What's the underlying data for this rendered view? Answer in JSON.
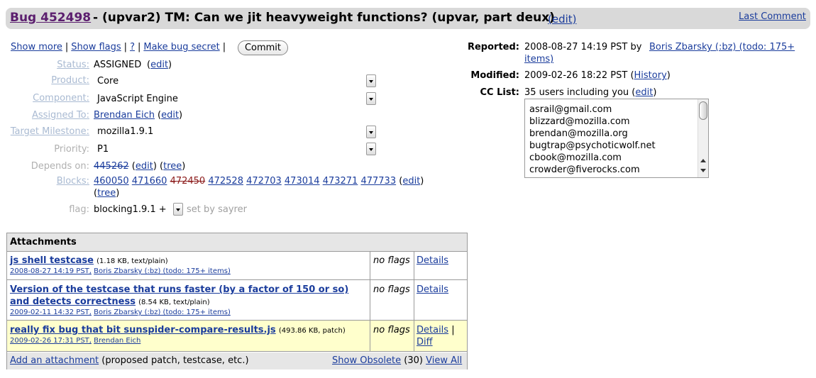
{
  "title": {
    "bug_id": "Bug 452498",
    "summary": "- (upvar2) TM: Can we jit heavyweight functions? (upvar, part deux)",
    "edit_label": "(edit)",
    "last_comment": "Last Comment"
  },
  "actions": {
    "show_more": "Show more",
    "show_flags": "Show flags",
    "help": "?",
    "make_secret": "Make bug secret",
    "commit": "Commit",
    "sep": "|"
  },
  "fields": {
    "status_label": "Status:",
    "status_value": "ASSIGNED",
    "status_edit": "edit",
    "product_label": "Product:",
    "product_value": "Core",
    "component_label": "Component:",
    "component_value": "JavaScript Engine",
    "assigned_label": "Assigned To:",
    "assigned_value": "Brendan Eich",
    "assigned_edit": "edit",
    "milestone_label": "Target Milestone:",
    "milestone_value": "mozilla1.9.1",
    "priority_label": "Priority:",
    "priority_value": "P1",
    "depends_label": "Depends on:",
    "depends_bug": "445262",
    "depends_edit": "edit",
    "depends_tree": "tree",
    "blocks_label": "Blocks:",
    "blocks": [
      "460050",
      "471660",
      "472450",
      "472528",
      "472703",
      "473014",
      "473271",
      "477733"
    ],
    "blocks_edit": "edit",
    "blocks_tree": "tree",
    "flag_label": "flag:",
    "flag_value": "blocking1.9.1 +",
    "flag_setter": "set by sayrer"
  },
  "meta": {
    "reported_label": "Reported:",
    "reported_date": "2008-08-27 14:19 PST by",
    "reporter": "Boris Zbarsky (:bz) (todo: 175+",
    "reporter_cont": "items)",
    "modified_label": "Modified:",
    "modified_date": "2009-02-26 18:22 PST (",
    "history": "History",
    "modified_close": ")",
    "cc_label": "CC List:",
    "cc_summary": "35 users including you (",
    "cc_edit": "edit",
    "cc_close": ")",
    "cc_list": [
      "asrail@gmail.com",
      "blizzard@mozilla.com",
      "brendan@mozilla.org",
      "bugtrap@psychoticwolf.net",
      "cbook@mozilla.com",
      "crowder@fiverocks.com"
    ]
  },
  "attachments": {
    "header": "Attachments",
    "rows": [
      {
        "title": "js shell testcase",
        "title2": "",
        "info": "(1.18 KB, text/plain)",
        "date": "2008-08-27 14:19 PST,",
        "author": "Boris Zbarsky (:bz) (todo: 175+ items)",
        "flags": "no flags",
        "details": "Details",
        "diff": ""
      },
      {
        "title": "Version of the testcase that runs faster (by a factor of 150 or so)",
        "title2": "and detects correctness",
        "info": "(8.54 KB, text/plain)",
        "date": "2009-02-11 14:32 PST,",
        "author": "Boris Zbarsky (:bz) (todo: 175+ items)",
        "flags": "no flags",
        "details": "Details",
        "diff": ""
      },
      {
        "title": "really fix bug that bit sunspider-compare-results.js",
        "title2": "",
        "info": "(493.86 KB, patch)",
        "date": "2009-02-26 17:31 PST,",
        "author": "Brendan Eich",
        "flags": "no flags",
        "details": "Details",
        "diff": "Diff",
        "pipe": "|"
      }
    ],
    "add": "Add an attachment",
    "add_hint": "(proposed patch, testcase, etc.)",
    "show_obsolete": "Show Obsolete",
    "obsolete_count": "(30)",
    "view_all": "View All"
  }
}
